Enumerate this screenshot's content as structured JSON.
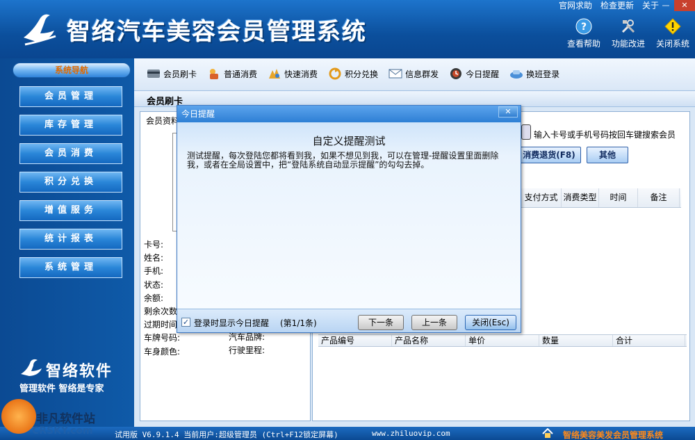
{
  "app": {
    "title": "智络汽车美容会员管理系统",
    "top_menu": [
      "官网求助",
      "检查更新",
      "关于"
    ],
    "window_buttons": [
      "—",
      "✕"
    ],
    "header_tools": [
      {
        "label": "查看帮助",
        "icon": "help-icon"
      },
      {
        "label": "功能改进",
        "icon": "tools-icon"
      },
      {
        "label": "关闭系统",
        "icon": "warning-icon"
      }
    ]
  },
  "sidebar": {
    "header": "系统导航",
    "items": [
      "会员管理",
      "库存管理",
      "会员消费",
      "积分兑换",
      "增值服务",
      "统计报表",
      "系统管理"
    ],
    "brand_name": "智络软件",
    "brand_slogan": "管理软件  智络是专家"
  },
  "toolbar": {
    "items": [
      {
        "label": "会员刷卡",
        "icon": "card-icon"
      },
      {
        "label": "普通消费",
        "icon": "consume-icon"
      },
      {
        "label": "快速消费",
        "icon": "fast-consume-icon"
      },
      {
        "label": "积分兑换",
        "icon": "points-icon"
      },
      {
        "label": "信息群发",
        "icon": "message-icon"
      },
      {
        "label": "今日提醒",
        "icon": "reminder-icon"
      },
      {
        "label": "换班登录",
        "icon": "shift-login-icon"
      }
    ]
  },
  "section": {
    "title": "会员刷卡"
  },
  "member_panel": {
    "legend": "会员资料",
    "fields": [
      "卡号:",
      "姓名:",
      "手机:",
      "状态:",
      "余额:",
      "剩余次数",
      "过期时间",
      "车牌号码:",
      "车身颜色:"
    ],
    "fields_right": [
      "汽车品牌:",
      "行驶里程:"
    ]
  },
  "right_panel": {
    "search_hint": "输入卡号或手机号码按回车键搜索会员",
    "refund_button": "消费退货(F8)",
    "other_button": "其他",
    "grid1_headers": [
      "支付方式",
      "消费类型",
      "时间",
      "备注"
    ],
    "grid2_headers": [
      "产品编号",
      "产品名称",
      "单价",
      "数量",
      "合计"
    ]
  },
  "dialog": {
    "title": "今日提醒",
    "close": "✕",
    "heading": "自定义提醒测试",
    "message": "测试提醒，每次登陆您都将看到我，如果不想见到我，可以在管理-提醒设置里面删除我，或者在全局设置中，把“登陆系统自动显示提醒”的勾勾去掉。",
    "checkbox_label": "登录时显示今日提醒",
    "checkbox_checked": true,
    "page_info": "(第1/1条)",
    "buttons": {
      "next": "下一条",
      "prev": "上一条",
      "close": "关闭(Esc)"
    }
  },
  "statusbar": {
    "text": "试用版 V6.9.1.4 当前用户:超级管理员 (Ctrl+F12锁定屏幕)",
    "url": "www.zhiluovip.com",
    "brand": "智络美容美发会员管理系统"
  },
  "watermark": {
    "line1": "非凡软件站",
    "line2": "CRSKY.com"
  },
  "colors": {
    "accent": "#0c4f99",
    "dialog_title": "#2d7fd5",
    "status_brand": "#ff8a1a"
  }
}
